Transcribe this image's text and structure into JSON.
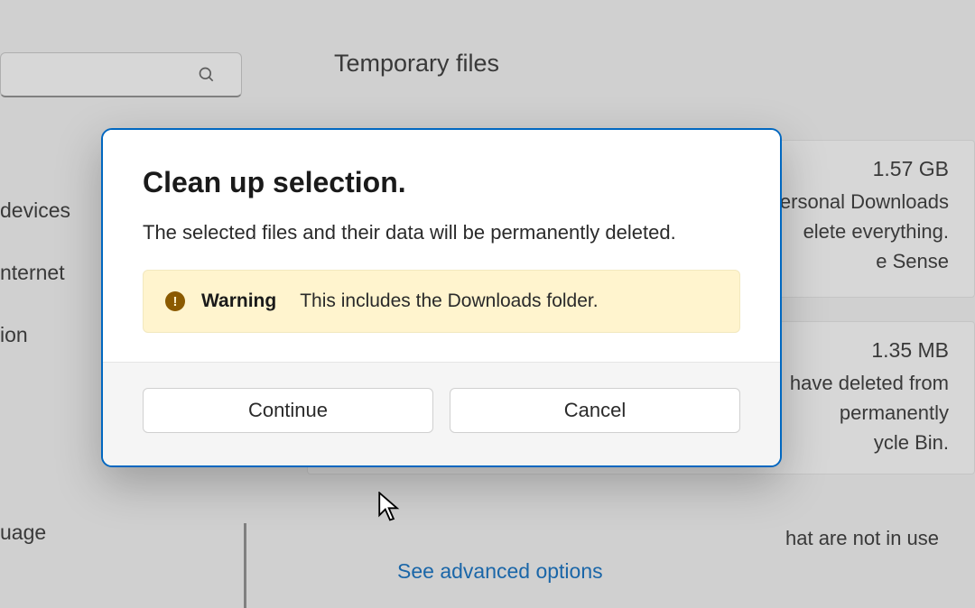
{
  "page": {
    "title": "Temporary files"
  },
  "sidebar": {
    "items": [
      {
        "label": "devices"
      },
      {
        "label": "nternet"
      },
      {
        "label": "ion"
      },
      {
        "label": "uage"
      }
    ]
  },
  "cards": [
    {
      "size": "1.57 GB",
      "text_lines": [
        "ersonal Downloads",
        "elete everything.",
        "e Sense"
      ]
    },
    {
      "size": "1.35 MB",
      "text_lines": [
        "have deleted from",
        " permanently",
        "ycle Bin."
      ]
    }
  ],
  "other": {
    "advanced_link": "See advanced options",
    "not_in_use": "hat are not in use"
  },
  "dialog": {
    "title": "Clean up selection.",
    "message": "The selected files and their data will be permanently deleted.",
    "warning": {
      "label": "Warning",
      "text": "This includes the Downloads folder."
    },
    "buttons": {
      "continue": "Continue",
      "cancel": "Cancel"
    }
  }
}
